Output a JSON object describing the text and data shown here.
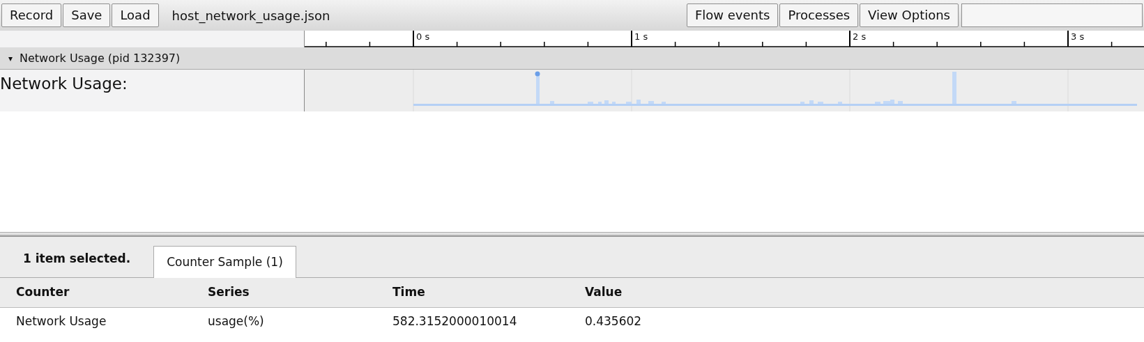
{
  "toolbar": {
    "buttons": [
      "Record",
      "Save",
      "Load"
    ],
    "filename": "host_network_usage.json",
    "right_buttons": [
      "Flow events",
      "Processes",
      "View Options"
    ]
  },
  "ruler": {
    "labels": [
      "0 s",
      "1 s",
      "2 s",
      "3 s"
    ]
  },
  "process": {
    "toggle": "▾",
    "expanded": true,
    "title": "Network Usage (pid 132397)"
  },
  "track": {
    "label": "Network Usage:"
  },
  "analysis": {
    "summary": "1 item selected.",
    "tabs": [
      {
        "label": "Counter Sample (1)",
        "selected": true
      }
    ],
    "table": {
      "columns": [
        "Counter",
        "Series",
        "Time",
        "Value"
      ],
      "rows": [
        [
          "Network Usage",
          "usage(%)",
          "582.3152000010014",
          "0.435602"
        ]
      ]
    }
  }
}
